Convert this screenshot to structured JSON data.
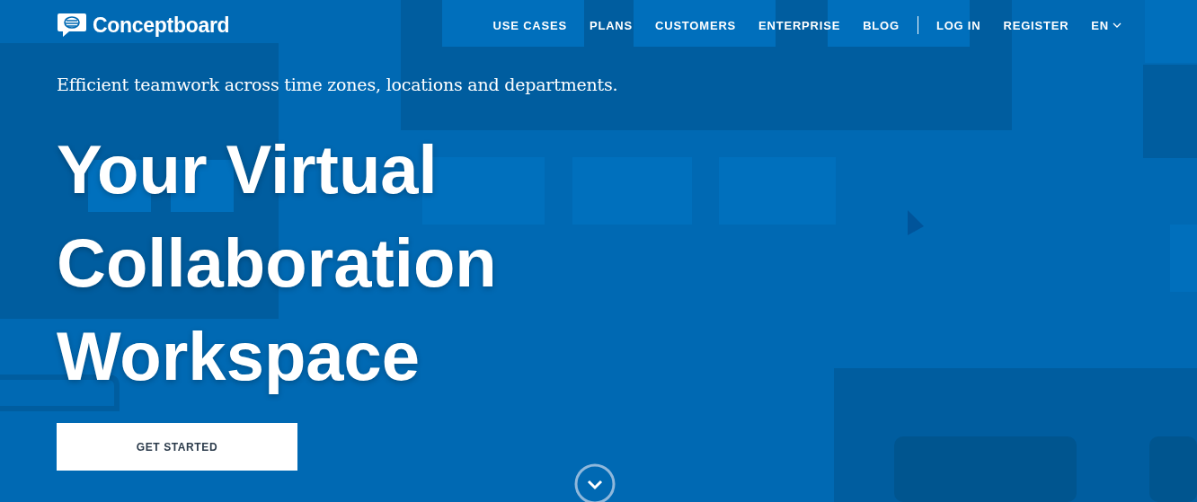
{
  "header": {
    "logo": "Conceptboard",
    "primary_links": [
      "USE CASES",
      "PLANS",
      "CUSTOMERS",
      "ENTERPRISE",
      "BLOG"
    ],
    "account_links": [
      "LOG IN",
      "REGISTER"
    ],
    "language": "EN"
  },
  "hero": {
    "tagline": "Efficient teamwork across time zones, locations and departments.",
    "headline_lines": [
      "Your Virtual",
      "Collaboration",
      "Workspace"
    ],
    "button": "GET STARTED"
  }
}
